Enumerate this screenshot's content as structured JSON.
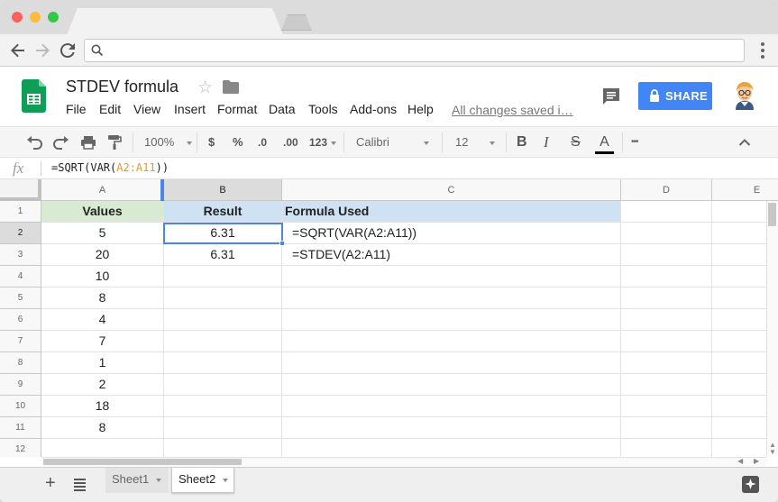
{
  "browser": {
    "address_value": ""
  },
  "doc": {
    "title": "STDEV formula",
    "menu": [
      "File",
      "Edit",
      "View",
      "Insert",
      "Format",
      "Data",
      "Tools",
      "Add-ons",
      "Help"
    ],
    "save_status": "All changes saved i…",
    "share_label": "SHARE",
    "accent_color": "#4285f4"
  },
  "toolbar": {
    "zoom": "100%",
    "currency": "$",
    "percent": "%",
    "decrease_decimals": ".0",
    "increase_decimals": ".00",
    "more_formats": "123",
    "font": "Calibri",
    "font_size": "12",
    "bold": "B",
    "italic": "I",
    "strikethrough": "S",
    "text_color": "A",
    "more": "•••"
  },
  "formula_bar": {
    "fx": "fx",
    "prefix": "=SQRT(VAR(",
    "ref": "A2:A11",
    "suffix": "))"
  },
  "grid": {
    "columns": [
      "A",
      "B",
      "C",
      "D",
      "E"
    ],
    "selected_column": "B",
    "selected_row": "2",
    "rows": [
      {
        "n": "1",
        "a": "Values",
        "b": "Result",
        "c": "Formula Used"
      },
      {
        "n": "2",
        "a": "5",
        "b": "6.31",
        "c": "=SQRT(VAR(A2:A11))"
      },
      {
        "n": "3",
        "a": "20",
        "b": "6.31",
        "c": "=STDEV(A2:A11)"
      },
      {
        "n": "4",
        "a": "10",
        "b": "",
        "c": ""
      },
      {
        "n": "5",
        "a": "8",
        "b": "",
        "c": ""
      },
      {
        "n": "6",
        "a": "4",
        "b": "",
        "c": ""
      },
      {
        "n": "7",
        "a": "7",
        "b": "",
        "c": ""
      },
      {
        "n": "8",
        "a": "1",
        "b": "",
        "c": ""
      },
      {
        "n": "9",
        "a": "2",
        "b": "",
        "c": ""
      },
      {
        "n": "10",
        "a": "18",
        "b": "",
        "c": ""
      },
      {
        "n": "11",
        "a": "8",
        "b": "",
        "c": ""
      },
      {
        "n": "12",
        "a": "",
        "b": "",
        "c": ""
      }
    ],
    "header_green": "#d9ead3",
    "header_blue": "#cfe2f3",
    "selection_color": "#4a86e8"
  },
  "sheets": {
    "tabs": [
      "Sheet1",
      "Sheet2"
    ],
    "active": "Sheet2"
  }
}
